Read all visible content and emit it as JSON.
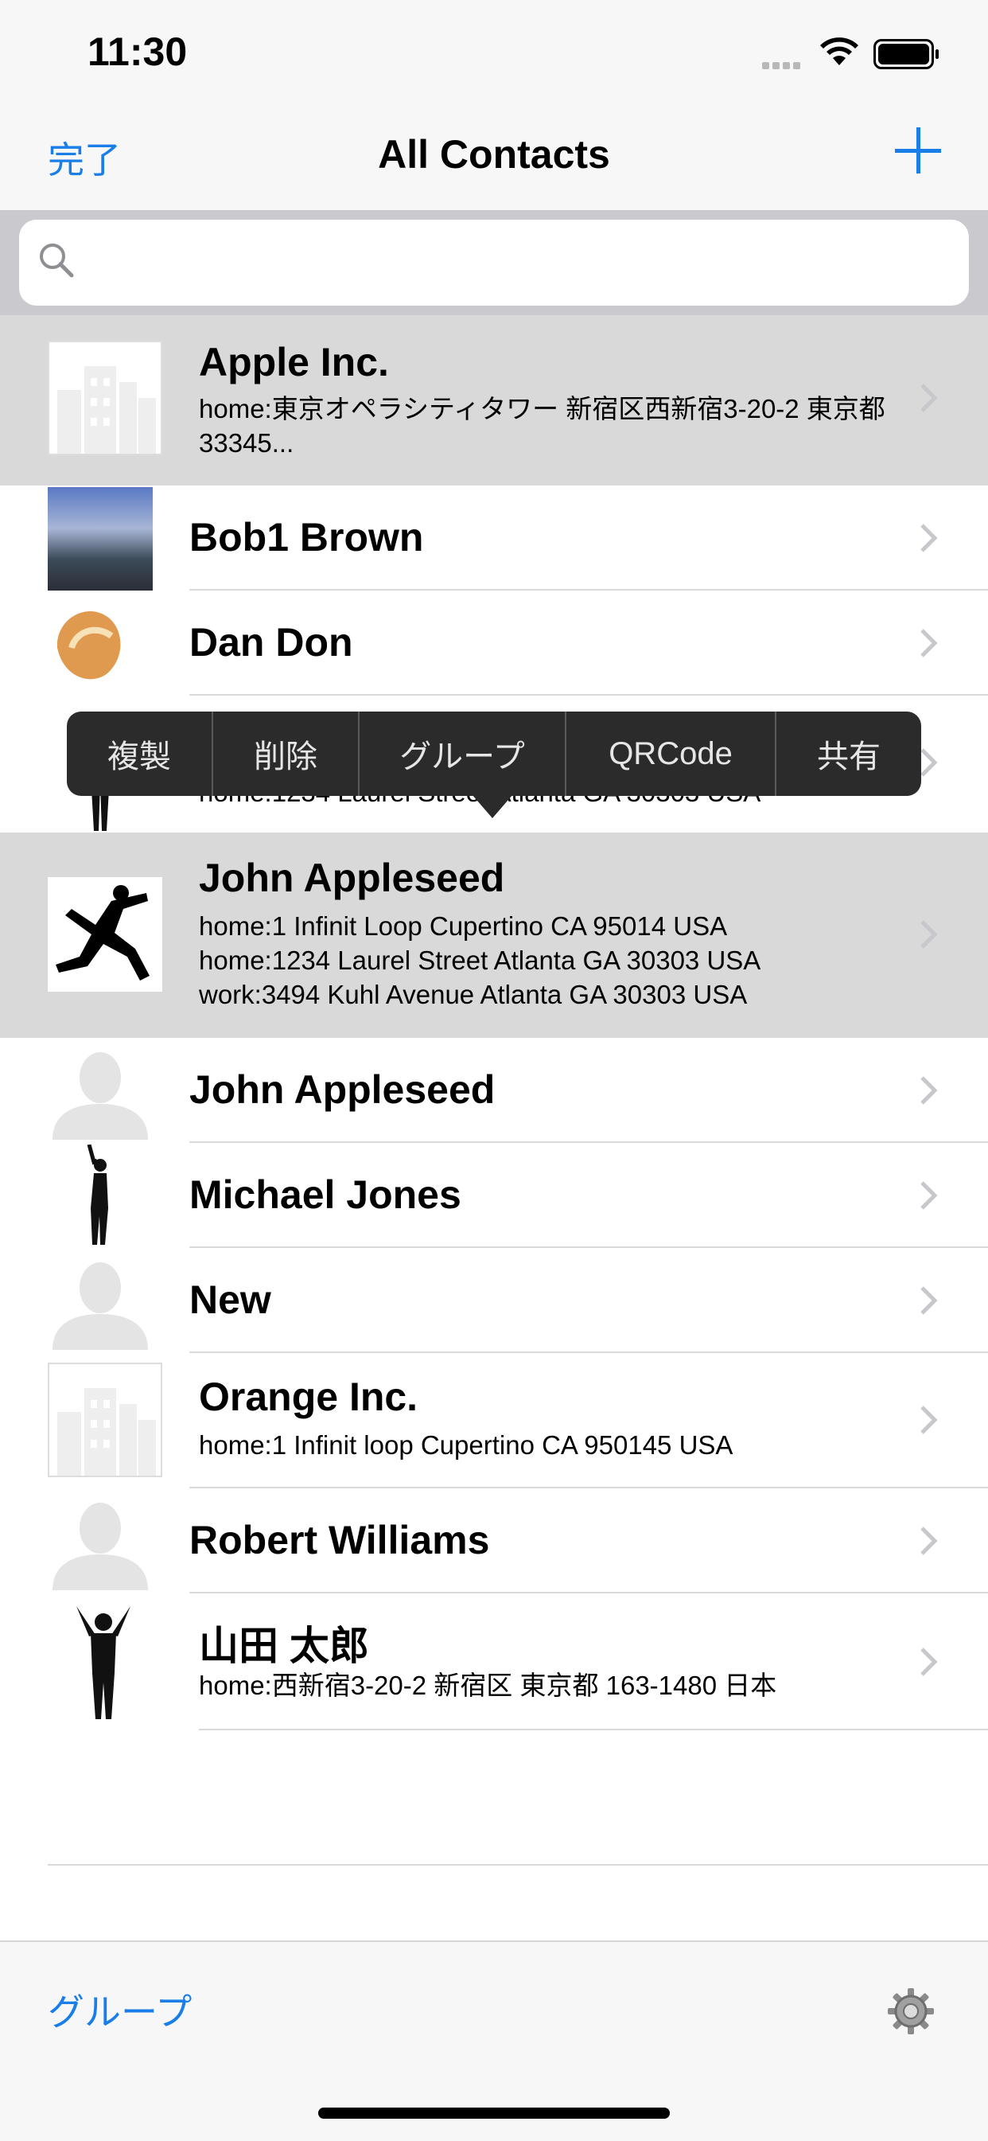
{
  "status_bar": {
    "time": "11:30"
  },
  "nav": {
    "done_label": "完了",
    "title": "All Contacts",
    "add_icon": "plus-icon"
  },
  "search": {
    "placeholder": "",
    "icon": "search-icon"
  },
  "contacts": [
    {
      "name": "Apple Inc.",
      "address": "home:東京オペラシティタワー 新宿区西新宿3-20-2 東京都 33345...",
      "avatar": "company-icon",
      "highlighted": true
    },
    {
      "name": "Bob1 Brown",
      "address": "",
      "avatar": "photo-landscape",
      "highlighted": false
    },
    {
      "name": "Dan Don",
      "address": "",
      "avatar": "fortune-cookie",
      "highlighted": false
    },
    {
      "name": "",
      "address": "home:1234 Laurel Street Atlanta GA 30303 USA",
      "avatar": "silhouette-person",
      "highlighted": false
    },
    {
      "name": "John Appleseed",
      "address": "home:1 Infinit Loop Cupertino CA 95014 USA\nhome:1234 Laurel Street Atlanta GA 30303 USA\nwork:3494 Kuhl Avenue Atlanta GA 30303 USA",
      "avatar": "silhouette-jumping",
      "highlighted": true
    },
    {
      "name": "John Appleseed",
      "address": "",
      "avatar": "default-person",
      "highlighted": false
    },
    {
      "name": "Michael Jones",
      "address": "",
      "avatar": "silhouette-dancer",
      "highlighted": false
    },
    {
      "name": "New",
      "address": "",
      "avatar": "default-person",
      "highlighted": false
    },
    {
      "name": "Orange Inc.",
      "address": "home:1 Infinit loop Cupertino CA 950145 USA",
      "avatar": "company-icon",
      "highlighted": false
    },
    {
      "name": "Robert Williams",
      "address": "",
      "avatar": "default-person",
      "highlighted": false
    },
    {
      "name": "山田 太郎",
      "address": "home:西新宿3-20-2 新宿区 東京都 163-1480 日本",
      "avatar": "silhouette-arms-up",
      "highlighted": false
    }
  ],
  "context_menu": {
    "items": [
      "複製",
      "削除",
      "グループ",
      "QRCode",
      "共有"
    ]
  },
  "toolbar": {
    "groups_label": "グループ",
    "settings_icon": "gear-icon"
  },
  "colors": {
    "accent": "#1a7ee8",
    "highlight": "#d9d9d9",
    "menu_bg": "#2b2b2b"
  }
}
